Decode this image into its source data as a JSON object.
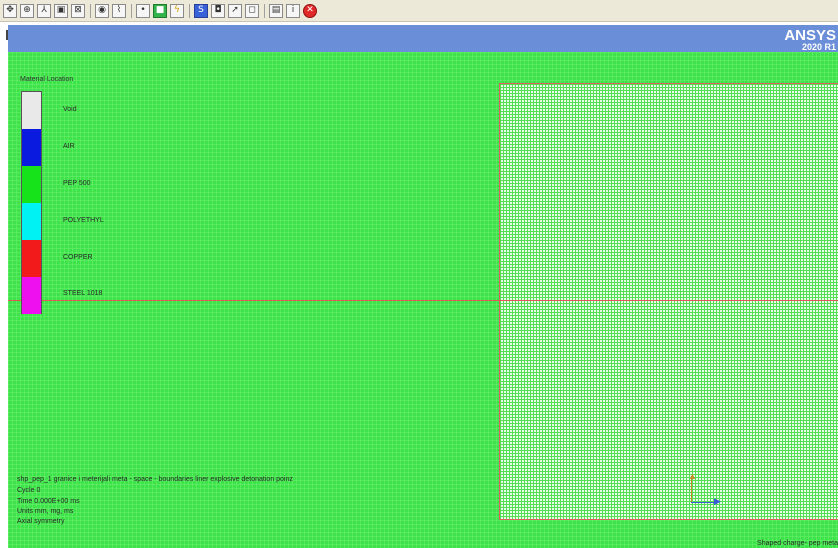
{
  "toolbar": {
    "buttons": [
      {
        "name": "pan-icon",
        "glyph": "✥"
      },
      {
        "name": "zoom-icon",
        "glyph": "⊕"
      },
      {
        "name": "rotate-icon",
        "glyph": "⅄"
      },
      {
        "name": "zoom-box-icon",
        "glyph": "▣"
      },
      {
        "name": "fit-view-icon",
        "glyph": "⊠"
      },
      {
        "name": "view-eye-icon",
        "glyph": "◉"
      },
      {
        "name": "graph-icon",
        "glyph": "⌇"
      },
      {
        "name": "settings-small-icon",
        "glyph": "•"
      },
      {
        "name": "material-color-icon",
        "glyph": "■"
      },
      {
        "name": "lightning-icon",
        "glyph": "ϟ"
      },
      {
        "name": "blue-view-icon",
        "glyph": "S"
      },
      {
        "name": "camera-icon",
        "glyph": "◘"
      },
      {
        "name": "arrow-tool-icon",
        "glyph": "➚"
      },
      {
        "name": "box-icon",
        "glyph": "◻"
      },
      {
        "name": "window-icon",
        "glyph": "▤"
      },
      {
        "name": "info-icon",
        "glyph": "i"
      },
      {
        "name": "stop-icon",
        "glyph": "✕"
      }
    ]
  },
  "banner": {
    "logo": "ANSYS",
    "version": "2020 R1"
  },
  "legend": {
    "title": "Material Location",
    "items": [
      {
        "label": "Void",
        "color": "#e9e9e9"
      },
      {
        "label": "AIR",
        "color": "#0a1adf"
      },
      {
        "label": "PEP 500",
        "color": "#16e31a"
      },
      {
        "label": "POLYETHYL",
        "color": "#00f2f2"
      },
      {
        "label": "COPPER",
        "color": "#f21a1a"
      },
      {
        "label": "STEEL 1018",
        "color": "#ee10ee"
      }
    ]
  },
  "info": {
    "line1": "shp_pep_1 granice i meterijali meta - space - boundaries liner explosive detonation poinz",
    "line2": "Cycle 0",
    "line3": "Time 0.000E+00 ms",
    "line4": "Units mm, mg, ms",
    "line5": "Axial symmetry"
  },
  "caption": "Shaped charge- pep meta",
  "colors": {
    "banner": "#6b8ed8",
    "grid_background": "#3ee24a",
    "axis_line": "#e05a5a"
  }
}
